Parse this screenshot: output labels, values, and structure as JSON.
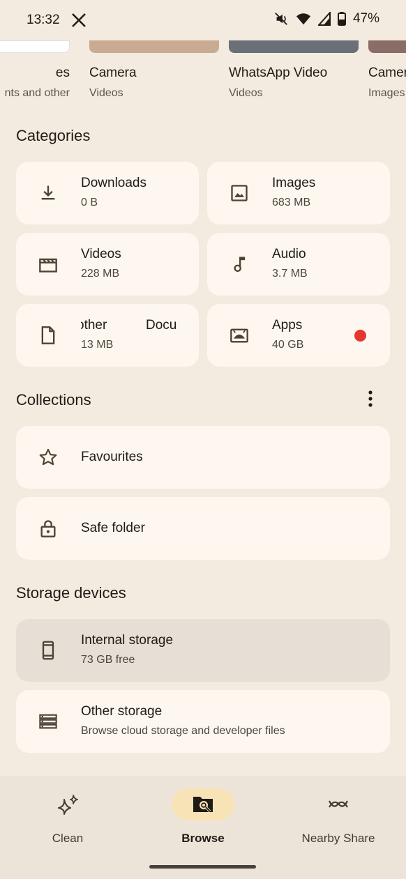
{
  "status_bar": {
    "time": "13:32",
    "battery": "47%",
    "icons": [
      "x-app-icon",
      "mute-icon",
      "wifi-icon",
      "signal-icon",
      "battery-icon"
    ]
  },
  "recent": [
    {
      "title": "es",
      "subtitle": "nts and other"
    },
    {
      "title": "Camera",
      "subtitle": "Videos"
    },
    {
      "title": "WhatsApp Video",
      "subtitle": "Videos"
    },
    {
      "title": "Camer",
      "subtitle": "Images"
    }
  ],
  "categories": {
    "title": "Categories",
    "items": [
      {
        "label": "Downloads",
        "size": "0 B",
        "icon": "download-icon"
      },
      {
        "label": "Images",
        "size": "683 MB",
        "icon": "image-icon"
      },
      {
        "label": "Videos",
        "size": "228 MB",
        "icon": "movie-icon"
      },
      {
        "label": "Audio",
        "size": "3.7 MB",
        "icon": "music-note-icon"
      },
      {
        "label": "other",
        "label_next": "Docu",
        "size": "13 MB",
        "icon": "document-icon"
      },
      {
        "label": "Apps",
        "size": "40 GB",
        "icon": "android-icon"
      }
    ]
  },
  "collections": {
    "title": "Collections",
    "items": [
      {
        "label": "Favourites",
        "icon": "star-icon"
      },
      {
        "label": "Safe folder",
        "icon": "lock-icon"
      }
    ]
  },
  "storage": {
    "title": "Storage devices",
    "items": [
      {
        "label": "Internal storage",
        "sub": "73 GB free",
        "icon": "phone-icon"
      },
      {
        "label": "Other storage",
        "sub": "Browse cloud storage and developer files",
        "icon": "storage-list-icon"
      }
    ]
  },
  "bottom_nav": {
    "items": [
      {
        "label": "Clean",
        "icon": "sparkle-icon"
      },
      {
        "label": "Browse",
        "icon": "folder-search-icon",
        "active": true
      },
      {
        "label": "Nearby Share",
        "icon": "nearby-share-icon"
      }
    ]
  },
  "colors": {
    "background": "#f3ebdf",
    "tile": "#fdf7ef",
    "selected_tile": "#e7ded6",
    "active_nav_pill": "#f8e3b6",
    "badge_red": "#e2362f"
  }
}
